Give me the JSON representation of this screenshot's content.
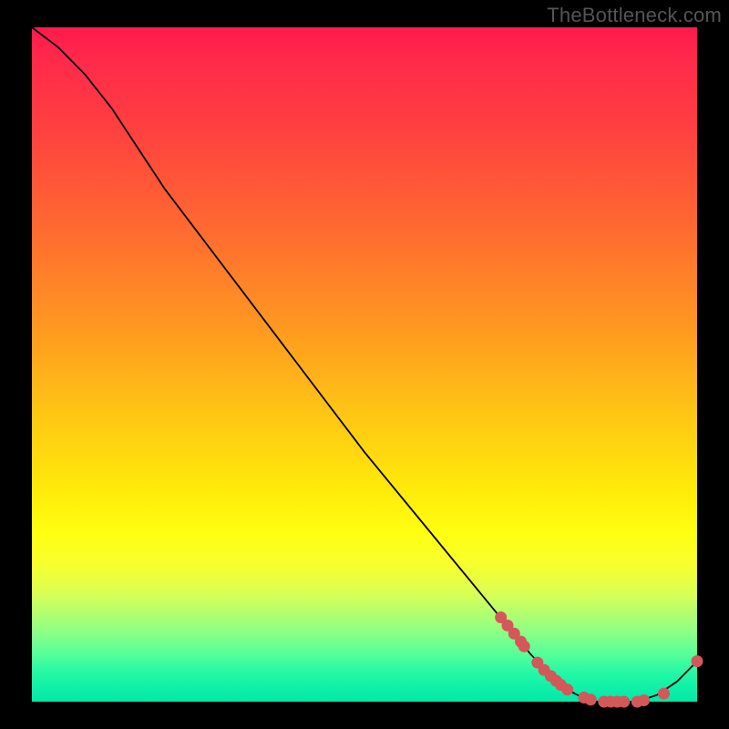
{
  "watermark": "TheBottleneck.com",
  "chart_data": {
    "type": "line",
    "title": "",
    "xlabel": "",
    "ylabel": "",
    "xlim": [
      0,
      100
    ],
    "ylim": [
      0,
      100
    ],
    "grid": false,
    "legend": false,
    "series": [
      {
        "name": "curve",
        "x": [
          0,
          4,
          8,
          12,
          16,
          20,
          30,
          40,
          50,
          60,
          70,
          75,
          78,
          80,
          82,
          85,
          88,
          91,
          94,
          97,
          100
        ],
        "y": [
          100,
          97,
          93,
          88,
          82,
          76,
          63,
          50,
          37,
          25,
          13,
          7,
          4,
          2,
          1,
          0,
          0,
          0,
          1,
          3,
          6
        ]
      }
    ],
    "markers": [
      {
        "x": 70.5,
        "y": 12.5
      },
      {
        "x": 71.5,
        "y": 11.3
      },
      {
        "x": 72.5,
        "y": 10.1
      },
      {
        "x": 73.5,
        "y": 8.9
      },
      {
        "x": 74.0,
        "y": 8.2
      },
      {
        "x": 76.0,
        "y": 5.8
      },
      {
        "x": 77.0,
        "y": 4.7
      },
      {
        "x": 78.0,
        "y": 3.8
      },
      {
        "x": 78.8,
        "y": 3.1
      },
      {
        "x": 79.5,
        "y": 2.5
      },
      {
        "x": 80.5,
        "y": 1.8
      },
      {
        "x": 83.0,
        "y": 0.6
      },
      {
        "x": 84.0,
        "y": 0.3
      },
      {
        "x": 86.0,
        "y": 0.0
      },
      {
        "x": 87.0,
        "y": 0.0
      },
      {
        "x": 88.0,
        "y": 0.0
      },
      {
        "x": 89.0,
        "y": 0.0
      },
      {
        "x": 91.0,
        "y": 0.0
      },
      {
        "x": 92.0,
        "y": 0.2
      },
      {
        "x": 95.0,
        "y": 1.2
      },
      {
        "x": 100.0,
        "y": 6.0
      }
    ],
    "marker_color": "#d4575a",
    "curve_color": "#000000"
  }
}
